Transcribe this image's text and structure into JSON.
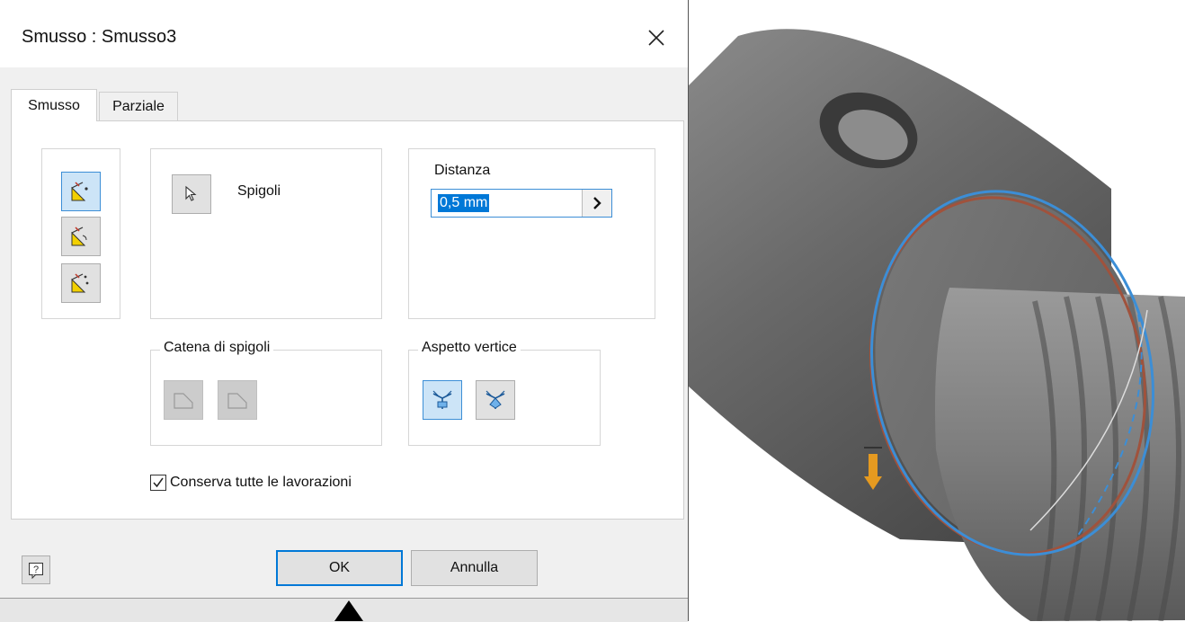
{
  "dialog": {
    "title": "Smusso : Smusso3",
    "tabs": [
      {
        "label": "Smusso",
        "active": true
      },
      {
        "label": "Parziale",
        "active": false
      }
    ],
    "edges": {
      "label": "Spigoli"
    },
    "distance": {
      "label": "Distanza",
      "value": "0,5 mm"
    },
    "edge_chain": {
      "label": "Catena di spigoli"
    },
    "corner_style": {
      "label": "Aspetto vertice"
    },
    "preserve_all": {
      "label": "Conserva tutte le lavorazioni",
      "checked": true
    },
    "buttons": {
      "ok": "OK",
      "cancel": "Annulla",
      "help": "?"
    }
  },
  "colors": {
    "accent": "#0078d7",
    "selection_blue": "#3c8ed6",
    "chamfer_edge": "#a0523c",
    "model_gray": "#6e6e6e"
  },
  "icons": {
    "close": "close-icon",
    "select_edges": "cursor-arrow-icon",
    "mode_distance": "chamfer-distance-icon",
    "mode_distance_angle": "chamfer-distance-angle-icon",
    "mode_two_distances": "chamfer-two-distances-icon",
    "chain_all": "edge-chain-all-icon",
    "chain_single": "edge-chain-single-icon",
    "setback": "corner-setback-icon",
    "no_setback": "corner-no-setback-icon",
    "help": "help-icon"
  }
}
